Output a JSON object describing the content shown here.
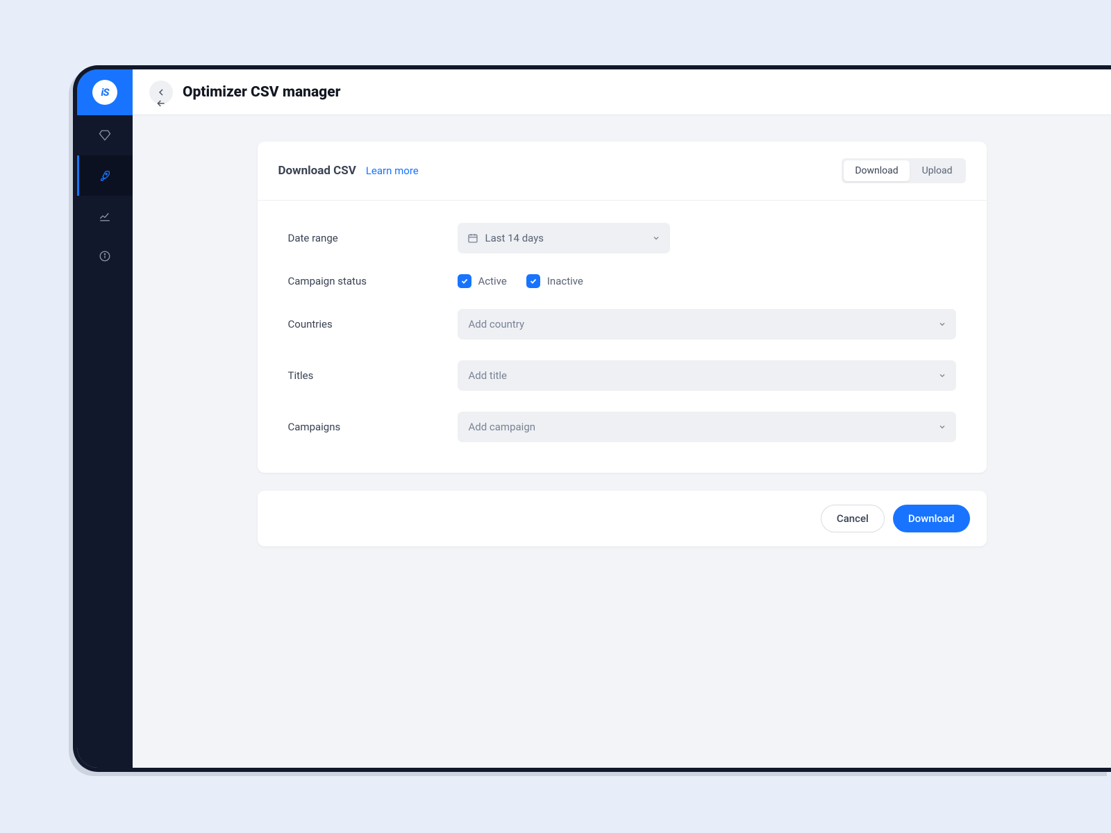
{
  "logo_text": "iS",
  "header": {
    "title": "Optimizer CSV manager"
  },
  "card": {
    "title": "Download CSV",
    "learn_more": "Learn more",
    "tabs": {
      "download": "Download",
      "upload": "Upload"
    }
  },
  "form": {
    "date_range": {
      "label": "Date range",
      "value": "Last 14 days"
    },
    "status": {
      "label": "Campaign status",
      "active": "Active",
      "inactive": "Inactive"
    },
    "countries": {
      "label": "Countries",
      "placeholder": "Add country"
    },
    "titles": {
      "label": "Titles",
      "placeholder": "Add title"
    },
    "campaigns": {
      "label": "Campaigns",
      "placeholder": "Add campaign"
    }
  },
  "actions": {
    "cancel": "Cancel",
    "download": "Download"
  }
}
